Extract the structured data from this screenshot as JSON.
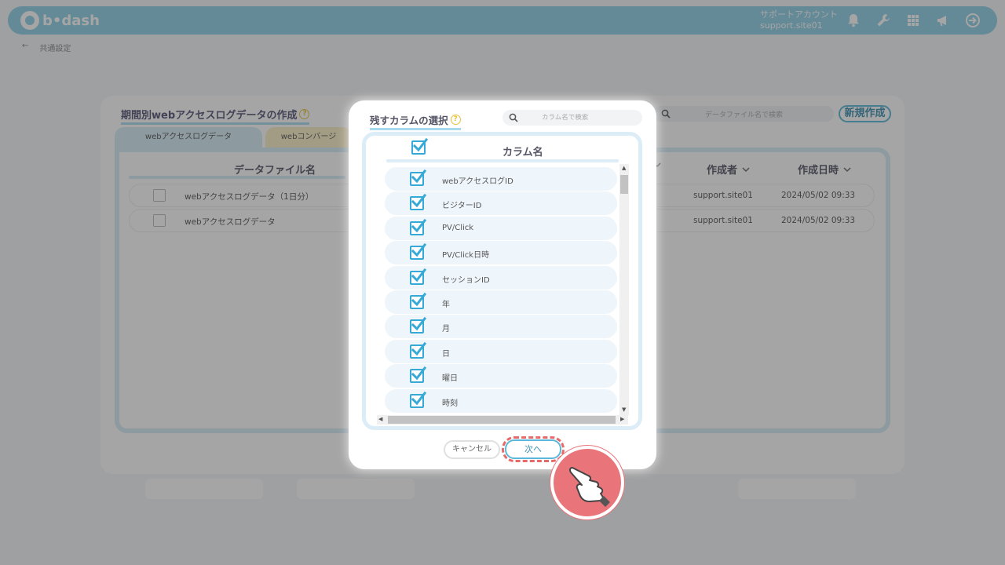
{
  "app": {
    "brand": "b•dash",
    "account_title": "サポートアカウント",
    "account_user": "support.site01",
    "breadcrumb_back": "←",
    "breadcrumb": "共通設定"
  },
  "panel": {
    "title": "期間別webアクセスログデータの作成",
    "search_placeholder": "データファイル名で検索",
    "new_button": "新規作成",
    "tabs": [
      "webアクセスログデータ",
      "webコンバージ"
    ],
    "columns": {
      "file_name": "データファイル名",
      "author": "作成者",
      "created": "作成日時"
    },
    "rows": [
      {
        "name": "webアクセスログデータ（1日分）",
        "author": "support.site01",
        "created": "2024/05/02 09:33"
      },
      {
        "name": "webアクセスログデータ",
        "author": "support.site01",
        "created": "2024/05/02 09:33"
      }
    ]
  },
  "modal": {
    "title": "残すカラムの選択",
    "search_placeholder": "カラム名で検索",
    "header_label": "カラム名",
    "columns": [
      {
        "label": "webアクセスログID",
        "checked": true
      },
      {
        "label": "ビジターID",
        "checked": true
      },
      {
        "label": "PV/Click",
        "checked": true
      },
      {
        "label": "PV/Click日時",
        "checked": true
      },
      {
        "label": "セッションID",
        "checked": true
      },
      {
        "label": "年",
        "checked": true
      },
      {
        "label": "月",
        "checked": true
      },
      {
        "label": "日",
        "checked": true
      },
      {
        "label": "曜日",
        "checked": true
      },
      {
        "label": "時刻",
        "checked": true
      }
    ],
    "cancel_label": "キャンセル",
    "next_label": "次へ"
  },
  "colors": {
    "accent": "#5bb8db",
    "header": "#8fd0e8",
    "highlight": "#e76a6a"
  },
  "icons": [
    "bell-icon",
    "wrench-icon",
    "grid-icon",
    "megaphone-icon",
    "logout-icon",
    "search-icon",
    "help-icon",
    "chevron-down-icon",
    "checkbox-checked-icon",
    "tap-hand-icon"
  ]
}
